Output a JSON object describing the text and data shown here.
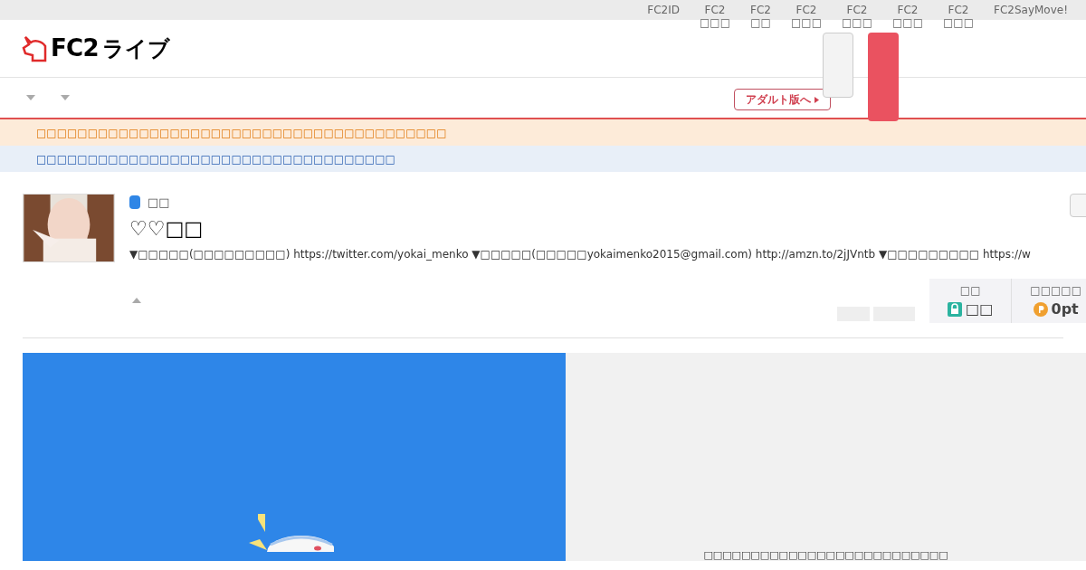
{
  "top_links": [
    "FC2ID",
    "FC2\n□□□",
    "FC2\n□□",
    "FC2\n□□□",
    "FC2\n□□□",
    "FC2\n□□□",
    "FC2\n□□□",
    "FC2SayMove!"
  ],
  "logo": {
    "text": "FC2",
    "sub": "ライブ"
  },
  "adult_button": "アダルト版へ",
  "notices": [
    {
      "kind": "warning",
      "text": "□□□□□□□□□□□□□□□□□□□□□□□□□□□□□□□□□□□□□□□□"
    },
    {
      "kind": "info",
      "text": "□□□□□□□□□□□□□□□□□□□□□□□□□□□□□□□□□□□"
    }
  ],
  "channel": {
    "category": "□□",
    "title": "♡♡□□",
    "description": "▼□□□□□(□□□□□□□□□) https://twitter.com/yokai_menko ▼□□□□□(□□□□□yokaimenko2015@gmail.com) http://amzn.to/2jJVntb ▼□□□□□□□□□ https://w"
  },
  "stats": [
    {
      "kind": "lock",
      "label": "□□",
      "value": "□□"
    },
    {
      "kind": "points",
      "label": "□□□□□",
      "value": "0pt"
    }
  ],
  "player": {
    "message": "□□□□□□□□□□□□□□□□□□□□□□□□□□"
  }
}
